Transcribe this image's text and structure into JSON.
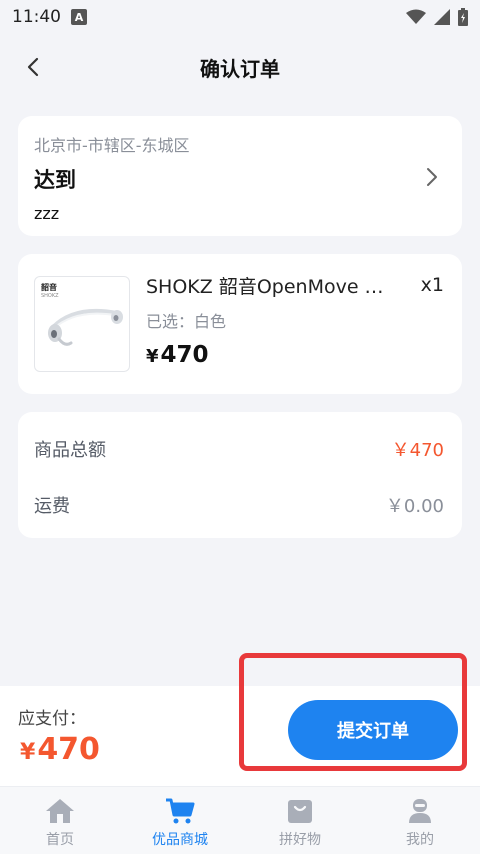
{
  "status_bar": {
    "time": "11:40",
    "notif_letter": "A"
  },
  "header": {
    "title": "确认订单"
  },
  "address": {
    "region": "北京市-市辖区-东城区",
    "detail": "达到",
    "contact": "zzz"
  },
  "product": {
    "name": "SHOKZ 韶音OpenMove …",
    "quantity": "x1",
    "spec": "已选：白色",
    "currency": "¥",
    "price": "470",
    "brand_mark": "韶音",
    "brand_sub": "SHOKZ"
  },
  "summary": {
    "subtotal_label": "商品总额",
    "subtotal_value": "￥470",
    "shipping_label": "运费",
    "shipping_value": "￥0.00"
  },
  "payment": {
    "label": "应支付：",
    "currency": "¥",
    "amount": "470",
    "submit_label": "提交订单"
  },
  "tabs": [
    {
      "label": "首页",
      "icon": "home-icon",
      "active": false
    },
    {
      "label": "优品商城",
      "icon": "cart-icon",
      "active": true
    },
    {
      "label": "拼好物",
      "icon": "bag-icon",
      "active": false
    },
    {
      "label": "我的",
      "icon": "profile-icon",
      "active": false
    }
  ],
  "colors": {
    "accent": "#1e83f0",
    "price_red": "#f4572f",
    "highlight": "#e8393b",
    "background": "#f3f4f8"
  }
}
